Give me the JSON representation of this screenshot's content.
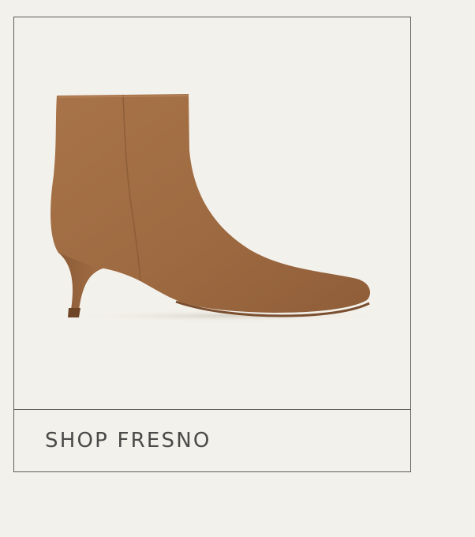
{
  "product_card": {
    "image": {
      "subject": "ankle-boot",
      "color": "#a06b43"
    },
    "cta_label": "SHOP FRESNO"
  },
  "colors": {
    "background": "#f3f1eb",
    "border": "#5d5c5a",
    "text": "#4a4a48"
  }
}
